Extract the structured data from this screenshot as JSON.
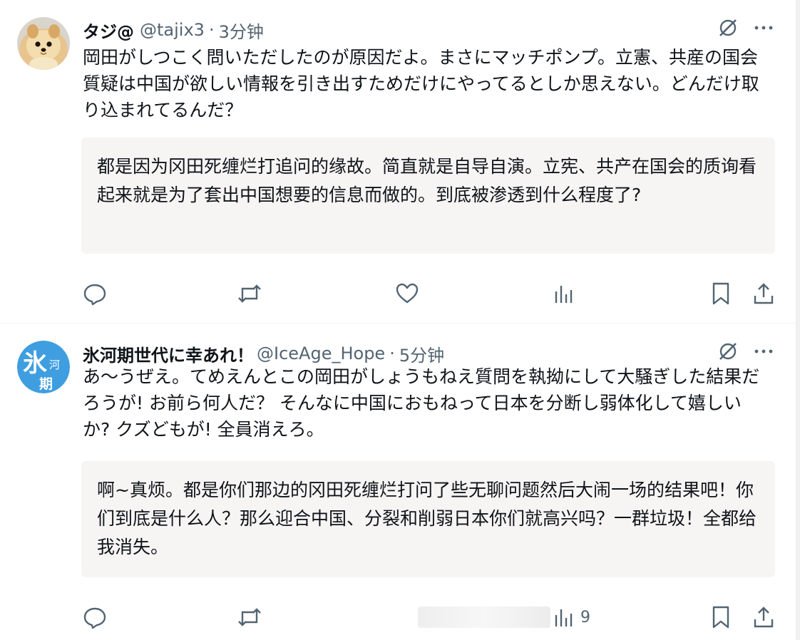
{
  "tweets": [
    {
      "display_name": "タジ@",
      "handle": "@tajix3",
      "separator": "·",
      "time": "3分钟",
      "text": "岡田がしつこく問いただしたのが原因だよ。まさにマッチポンプ。立憲、共産の国会質疑は中国が欲しい情報を引き出すためだけにやってるとしか思えない。どんだけ取り込まれてるんだ？",
      "translation": "都是因为冈田死缠烂打追问的缘故。简直就是自导自演。立宪、共产在国会的质询看起来就是为了套出中国想要的信息而做的。到底被渗透到什么程度了?",
      "views": ""
    },
    {
      "display_name": "氷河期世代に幸あれ！",
      "handle": "@IceAge_Hope",
      "separator": "·",
      "time": "5分钟",
      "text": "あ〜うぜえ。てめえんとこの岡田がしょうもねえ質問を執拗にして大騒ぎした結果だろうが! お前ら何人だ？ そんなに中国におもねって日本を分断し弱体化して嬉しいか? クズどもが! 全員消えろ。",
      "translation": "啊~真烦。都是你们那边的冈田死缠烂打问了些无聊问题然后大闹一场的结果吧！你们到底是什么人？那么迎合中国、分裂和削弱日本你们就高兴吗？一群垃圾！全都给我消失。",
      "views": "9",
      "avatar_text_main": "氷",
      "avatar_text_small_1": "河",
      "avatar_text_small_2": "期"
    }
  ],
  "colors": {
    "text_primary": "#0f1419",
    "text_secondary": "#536471",
    "translation_bg": "#f7f4f4",
    "avatar2_bg": "#3f9ee0"
  },
  "icons": [
    "grok-icon",
    "more-icon",
    "reply-icon",
    "retweet-icon",
    "like-icon",
    "views-icon",
    "bookmark-icon",
    "share-icon"
  ]
}
